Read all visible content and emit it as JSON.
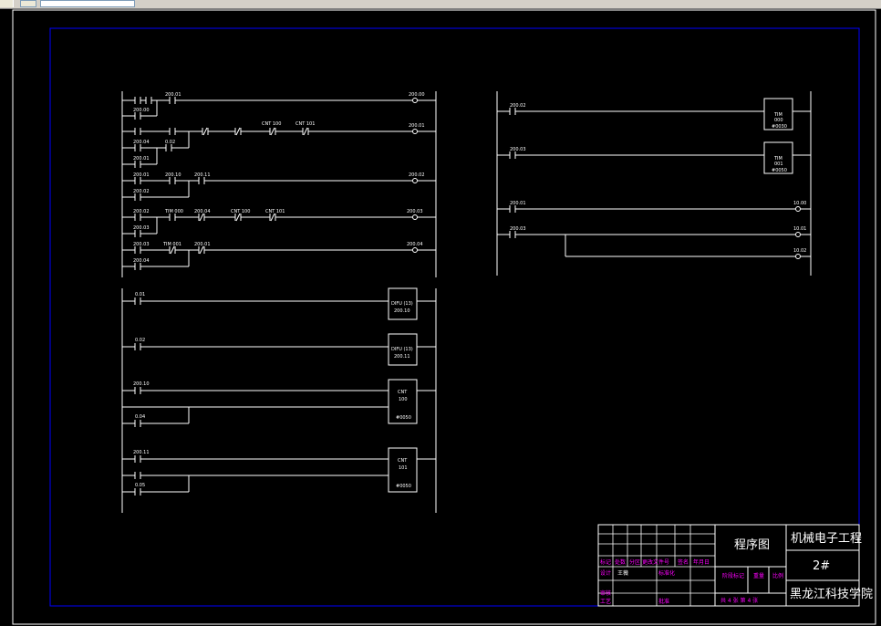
{
  "toolbar": {
    "buttons": [
      "toolbar-button",
      "window-icon",
      "address-field"
    ]
  },
  "diagram": {
    "colors": {
      "background": "#000000",
      "lines": "#ffffff",
      "border": "#0000ff",
      "tb_text": "#ff00ff"
    },
    "rung_labels": {
      "r1": [
        "200.01",
        "200.00",
        "200.00"
      ],
      "r2": [
        "CNT 100",
        "CNT 101",
        "200.01",
        "200.04",
        "0.02",
        "200.01"
      ],
      "r3": [
        "200.01",
        "200.10",
        "200.11",
        "200.02",
        "200.02"
      ],
      "r4": [
        "200.02",
        "TIM 000",
        "200.04",
        "CNT 100",
        "CNT 101",
        "200.03",
        "200.03"
      ],
      "r5": [
        "200.03",
        "TIM 001",
        "200.01",
        "200.04",
        "200.04"
      ],
      "r6": [
        "0.01",
        "DIFU (13)",
        "200.10"
      ],
      "r7": [
        "0.02",
        "DIFU (13)",
        "200.11"
      ],
      "r8": [
        "200.10",
        "0.04",
        "CNT",
        "100",
        "#0050"
      ],
      "r9": [
        "200.11",
        "0.05",
        "CNT",
        "101",
        "#0050"
      ],
      "right": [
        "200.02",
        "TIM",
        "000",
        "#0030",
        "200.03",
        "TIM",
        "001",
        "#0050",
        "200.01",
        "10.00",
        "200.03",
        "10.01",
        "10.02"
      ]
    },
    "title_block": {
      "drawing_title": "程序图",
      "project": "机械电子工程",
      "number": "2#",
      "school": "黑龙江科技学院",
      "row_headers": [
        "标记",
        "处数",
        "分区",
        "更改文件号",
        "签名",
        "年月日"
      ],
      "design_row": [
        "设计",
        "王薇",
        "标准化"
      ],
      "stage_labels": [
        "阶段标记",
        "重量",
        "比例"
      ],
      "audit": "审核",
      "process": "工艺",
      "approve": "批准",
      "sheets": "共 4 张  第 4 张"
    }
  }
}
